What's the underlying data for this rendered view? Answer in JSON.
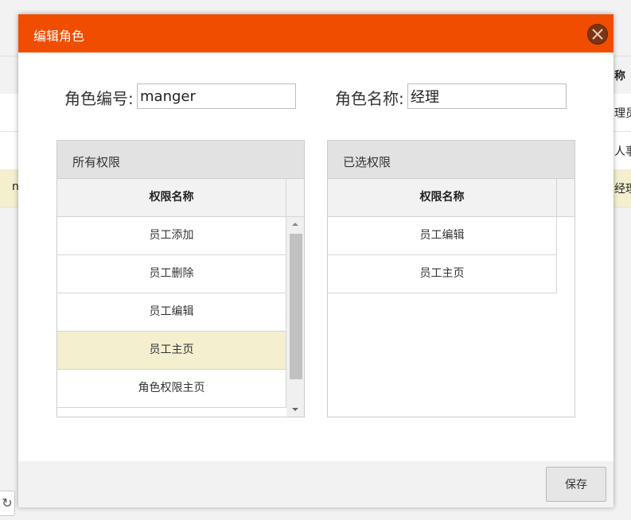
{
  "background": {
    "header_text": "称",
    "rows": [
      {
        "left": "",
        "right": "理员"
      },
      {
        "left": "",
        "right": "人事"
      },
      {
        "left": "n",
        "right": "经理"
      }
    ],
    "refresh_icon": "refresh-icon"
  },
  "dialog": {
    "title": "编辑角色",
    "close_icon": "close-icon",
    "role_id": {
      "label": "角色编号:",
      "value": "manger"
    },
    "role_name": {
      "label": "角色名称:",
      "value": "经理"
    },
    "all_permissions": {
      "title": "所有权限",
      "column": "权限名称",
      "rows": [
        "员工添加",
        "员工删除",
        "员工编辑",
        "员工主页",
        "角色权限主页"
      ],
      "selected_index": 3
    },
    "selected_permissions": {
      "title": "已选权限",
      "column": "权限名称",
      "rows": [
        "员工编辑",
        "员工主页"
      ]
    },
    "save_label": "保存"
  },
  "colors": {
    "header": "#f04d00",
    "selected_row": "#f3efcf",
    "close_button": "#7a3515"
  }
}
